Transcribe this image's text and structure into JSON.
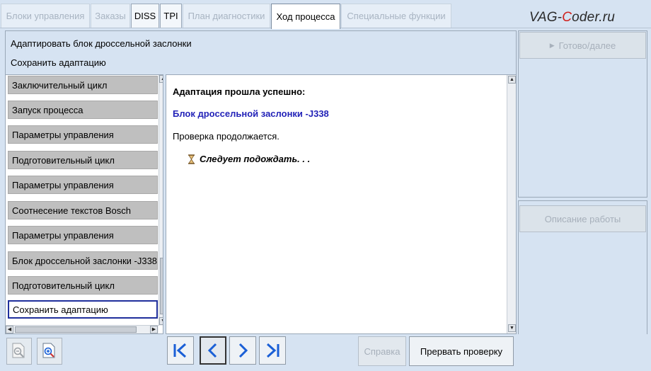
{
  "tabs": [
    {
      "label": "Блоки управления",
      "state": "disabled"
    },
    {
      "label": "Заказы",
      "state": "disabled"
    },
    {
      "label": "DISS",
      "state": "enabled"
    },
    {
      "label": "TPI",
      "state": "enabled"
    },
    {
      "label": "План диагностики",
      "state": "disabled"
    },
    {
      "label": "Ход процесса",
      "state": "active"
    },
    {
      "label": "Специальные функции",
      "state": "disabled"
    }
  ],
  "brand": {
    "prefix": "VAG-",
    "accent": "C",
    "suffix": "oder.ru"
  },
  "header": {
    "line1": "Адаптировать блок дроссельной заслонки",
    "line2": "Сохранить адаптацию"
  },
  "steps": [
    {
      "label": "Заключительный цикл"
    },
    {
      "label": "Запуск процесса"
    },
    {
      "label": "Параметры управления"
    },
    {
      "label": "Подготовительный цикл"
    },
    {
      "label": "Параметры управления"
    },
    {
      "label": "Соотнесение текстов Bosch"
    },
    {
      "label": "Параметры управления"
    },
    {
      "label": "Блок дроссельной заслонки -J338"
    },
    {
      "label": "Подготовительный цикл"
    },
    {
      "label": "Сохранить адаптацию"
    }
  ],
  "selected_step_index": 9,
  "content": {
    "heading": "Адаптация прошла успешно:",
    "unit": "Блок дроссельной заслонки -J338",
    "status": "Проверка продолжается.",
    "wait": "Следует подождать. . ."
  },
  "right": {
    "next_label": "Готово/далее",
    "next_icon": "play-icon",
    "description_label": "Описание работы"
  },
  "toolbar": {
    "zoom_out_icon": "zoom-out-icon",
    "zoom_in_icon": "zoom-in-icon",
    "help_label": "Справка",
    "abort_label": "Прервать проверку"
  },
  "colors": {
    "background": "#d6e3f2",
    "selected_border": "#1f2f9c",
    "unit_text": "#2323b8",
    "nav_arrow": "#1a5fd6",
    "brand_accent": "#d0201c"
  }
}
